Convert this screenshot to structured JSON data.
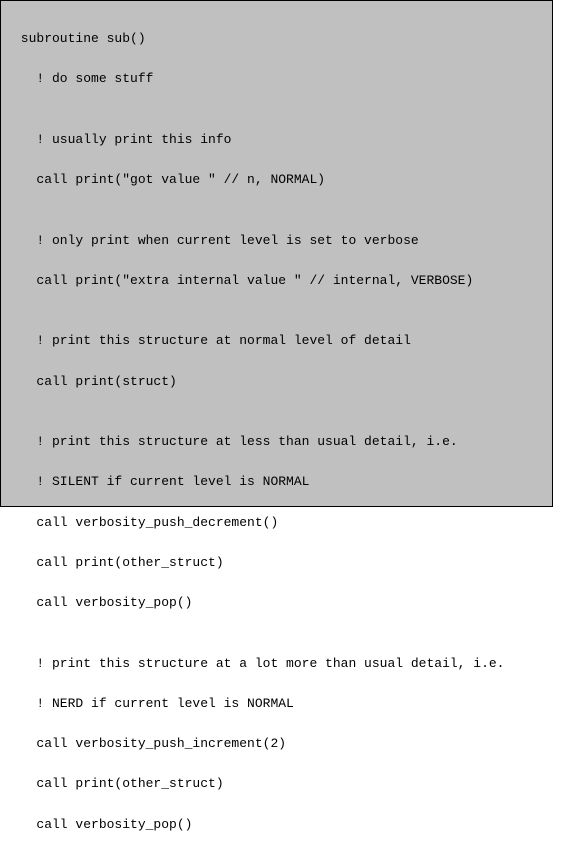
{
  "code": {
    "lines": [
      " subroutine sub()",
      "   ! do some stuff",
      "",
      "   ! usually print this info",
      "   call print(\"got value \" // n, NORMAL)",
      "",
      "   ! only print when current level is set to verbose",
      "   call print(\"extra internal value \" // internal, VERBOSE)",
      "",
      "   ! print this structure at normal level of detail",
      "   call print(struct)",
      "",
      "   ! print this structure at less than usual detail, i.e.",
      "   ! SILENT if current level is NORMAL",
      "   call verbosity_push_decrement()",
      "   call print(other_struct)",
      "   call verbosity_pop()",
      "",
      "   ! print this structure at a lot more than usual detail, i.e.",
      "   ! NERD if current level is NORMAL",
      "   call verbosity_push_increment(2)",
      "   call print(other_struct)",
      "   call verbosity_pop()"
    ]
  }
}
